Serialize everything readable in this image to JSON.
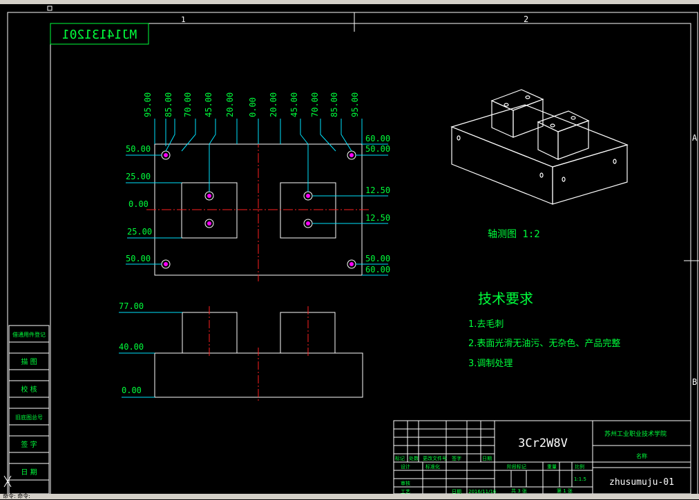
{
  "drawing_number": "MJ14131201",
  "zone_markers": {
    "top": [
      "1",
      "2"
    ],
    "right": [
      "A",
      "B"
    ]
  },
  "plan_view": {
    "x_dims": [
      "95.00",
      "85.00",
      "70.00",
      "45.00",
      "20.00",
      "0.00",
      "20.00",
      "45.00",
      "70.00",
      "85.00",
      "95.00"
    ],
    "left_y_dims": [
      "50.00",
      "25.00",
      "0.00",
      "25.00",
      "50.00"
    ],
    "right_y_dims": [
      "60.00",
      "50.00",
      "12.50",
      "12.50",
      "50.00",
      "60.00"
    ]
  },
  "front_view": {
    "y_dims": [
      "77.00",
      "40.00",
      "0.00"
    ]
  },
  "iso_label": "轴测图 1:2",
  "tech_requirements": {
    "title": "技术要求",
    "items": [
      "1.去毛刺",
      "2.表面光滑无油污、无杂色、产品完整",
      "3.调制处理"
    ]
  },
  "left_strip": [
    "借通用件登记",
    "描 图",
    "校 核",
    "旧底图总号",
    "签 字",
    "日 期"
  ],
  "title_block": {
    "material": "3Cr2W8V",
    "school": "苏州工业职业技术学院",
    "drawing_name": "zhusumuju-01",
    "name_label": "名称",
    "row_labels": [
      "标记",
      "处数",
      "更改文件号",
      "签字",
      "日期"
    ],
    "designer_label": "设计",
    "standard_label": "标准化",
    "review_label": "审核",
    "process_label": "工艺",
    "date_label": "日期",
    "date_value": "2016/11/16",
    "stage_label": "阶段标记",
    "weight_label": "重量",
    "scale_label": "比例",
    "scale_value": "1:1.5",
    "sheets_total": "共 3 张",
    "sheet_no": "第 1 张"
  },
  "status_text": "命令: 命令:"
}
